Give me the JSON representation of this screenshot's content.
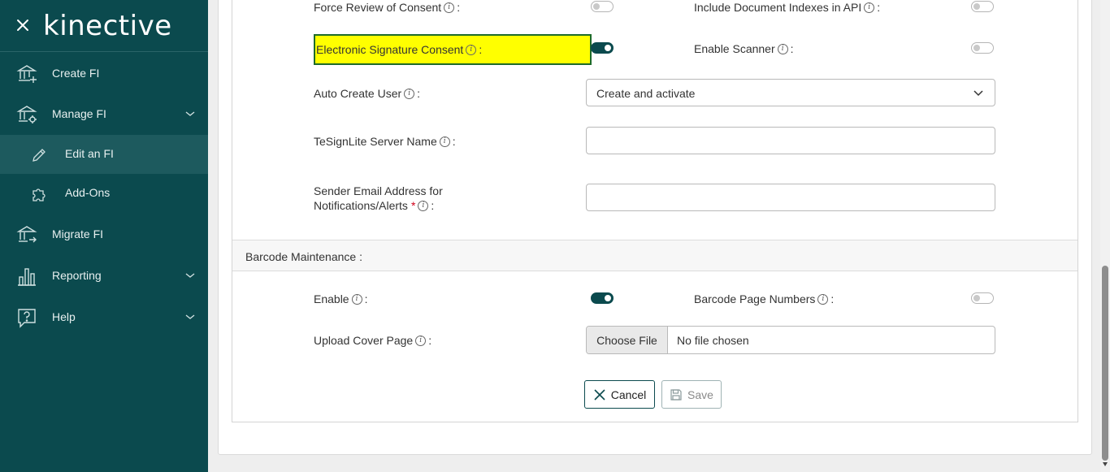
{
  "app": {
    "logo_text": "kinective"
  },
  "sidebar": {
    "items": [
      {
        "label": "Create FI",
        "icon": "bank-plus-icon"
      },
      {
        "label": "Manage FI",
        "icon": "bank-gear-icon",
        "expandable": true
      },
      {
        "label": "Edit an FI",
        "icon": "pencil-icon",
        "sub": true,
        "active": true
      },
      {
        "label": "Add-Ons",
        "icon": "puzzle-icon",
        "sub": true
      },
      {
        "label": "Migrate FI",
        "icon": "bank-arrow-icon"
      },
      {
        "label": "Reporting",
        "icon": "bar-chart-icon",
        "expandable": true
      },
      {
        "label": "Help",
        "icon": "help-bubble-icon",
        "expandable": true
      }
    ]
  },
  "form": {
    "force_review_label": "Force Review of Consent",
    "include_doc_indexes_label": "Include Document Indexes in API",
    "esign_consent_label": "Electronic Signature Consent",
    "enable_scanner_label": "Enable Scanner",
    "auto_create_user_label": "Auto Create User",
    "auto_create_user_value": "Create and activate",
    "tesignlite_label": "TeSignLite Server Name",
    "tesignlite_value": "",
    "sender_email_label_line1": "Sender Email Address for",
    "sender_email_label_line2": "Notifications/Alerts",
    "sender_email_value": "",
    "required_mark": "*",
    "colon": ":",
    "toggles": {
      "force_review": false,
      "include_doc_indexes": false,
      "esign_consent": true,
      "enable_scanner": false,
      "barcode_enable": true,
      "barcode_page_numbers": false
    }
  },
  "barcode": {
    "section_label": "Barcode Maintenance :",
    "enable_label": "Enable",
    "page_numbers_label": "Barcode Page Numbers",
    "upload_label": "Upload Cover Page",
    "choose_file_label": "Choose File",
    "no_file_text": "No file chosen"
  },
  "actions": {
    "cancel_label": "Cancel",
    "save_label": "Save"
  },
  "colors": {
    "brand": "#0b4a4e",
    "highlight": "#ffff00"
  }
}
